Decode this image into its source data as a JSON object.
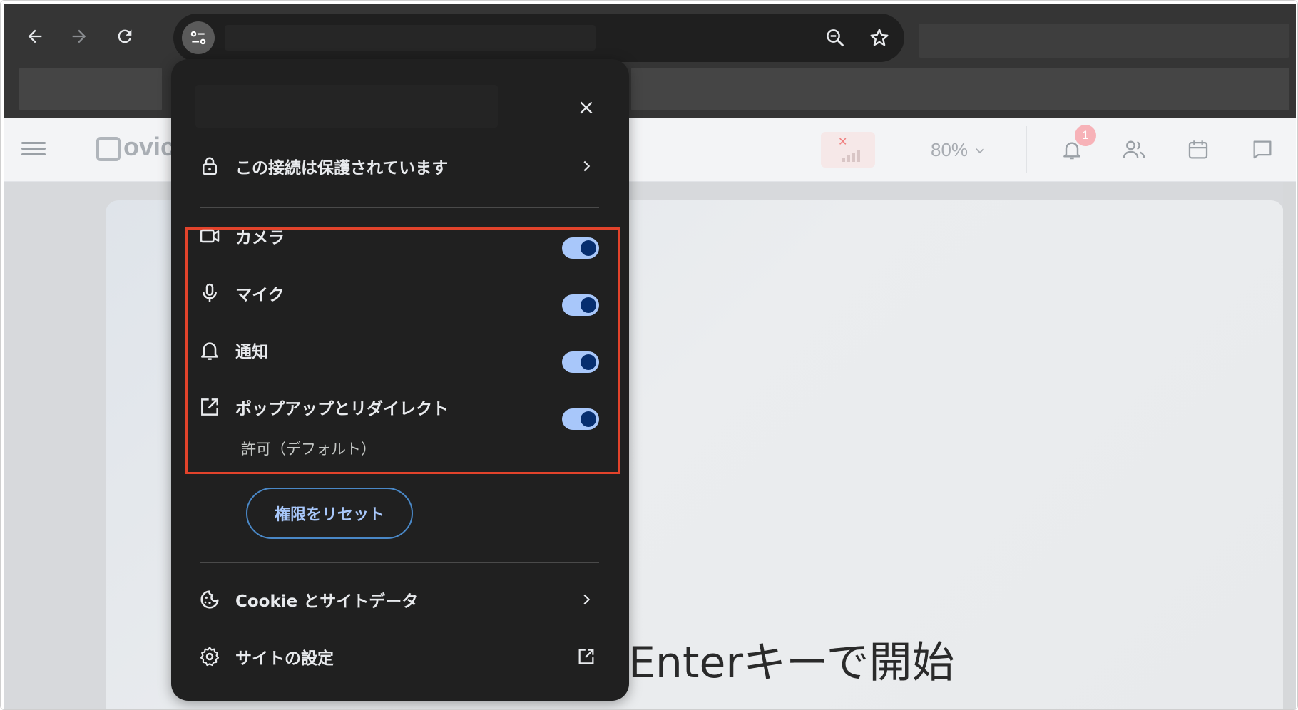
{
  "browser": {
    "back_icon": "arrow-left-icon",
    "forward_icon": "arrow-right-icon",
    "reload_icon": "reload-icon",
    "site_info_icon": "tune-icon",
    "zoom_icon": "zoom-out-icon",
    "bookmark_icon": "star-icon"
  },
  "page_header": {
    "logo_text": "ovic",
    "zoom_value": "80%",
    "notification_count": "1"
  },
  "page_body": {
    "partial_text": "Enterキーで開始"
  },
  "popup": {
    "connection_label": "この接続は保護されています",
    "permissions": [
      {
        "label": "カメラ",
        "enabled": true,
        "icon": "video-camera-icon"
      },
      {
        "label": "マイク",
        "enabled": true,
        "icon": "microphone-icon"
      },
      {
        "label": "通知",
        "enabled": true,
        "icon": "bell-icon"
      },
      {
        "label": "ポップアップとリダイレクト",
        "sublabel": "許可（デフォルト）",
        "enabled": true,
        "icon": "open-in-new-icon"
      }
    ],
    "reset_label": "権限をリセット",
    "cookies_label": "Cookie とサイトデータ",
    "site_settings_label": "サイトの設定"
  },
  "colors": {
    "highlight": "#e2432b",
    "toggle_track": "#a8c7fa",
    "toggle_knob": "#062e6f",
    "popup_bg": "#202020"
  }
}
